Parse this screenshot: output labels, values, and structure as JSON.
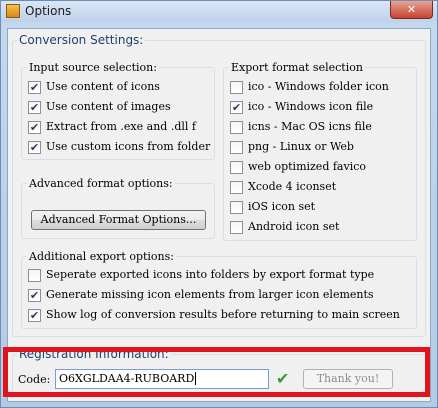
{
  "window": {
    "title": "Options",
    "close_label": "✕"
  },
  "conversion_settings": {
    "heading": "Conversion Settings:"
  },
  "input_source": {
    "label": "Input source selection:",
    "items": [
      {
        "label": "Use content of icons",
        "checked": true
      },
      {
        "label": "Use content of images",
        "checked": true
      },
      {
        "label": "Extract from .exe and .dll f",
        "checked": true
      },
      {
        "label": "Use custom icons from folder",
        "checked": true
      }
    ]
  },
  "advanced": {
    "label": "Advanced format options:",
    "button_label": "Advanced Format Options..."
  },
  "export_format": {
    "label": "Export format selection",
    "items": [
      {
        "label": "ico - Windows folder icon",
        "checked": false
      },
      {
        "label": "ico - Windows icon file",
        "checked": true
      },
      {
        "label": "icns - Mac OS icns file",
        "checked": false
      },
      {
        "label": "png - Linux or Web",
        "checked": false
      },
      {
        "label": "web optimized favico",
        "checked": false
      },
      {
        "label": "Xcode 4 iconset",
        "checked": false
      },
      {
        "label": "iOS icon set",
        "checked": false
      },
      {
        "label": "Android icon set",
        "checked": false
      }
    ]
  },
  "additional": {
    "label": "Additional export options:",
    "items": [
      {
        "label": "Seperate exported icons into folders by export format type",
        "checked": false
      },
      {
        "label": "Generate missing icon elements from larger icon elements",
        "checked": true
      },
      {
        "label": "Show log of conversion results before returning to main screen",
        "checked": true
      }
    ]
  },
  "registration": {
    "heading": "Registration Information:",
    "code_label": "Code:",
    "code_value": "O6XGLDAA4-RUBOARD",
    "thank_you_label": "Thank you!",
    "checkmark": "✔"
  },
  "colors": {
    "highlight": "#e0141b",
    "checkmark": "#3a9a2e"
  }
}
